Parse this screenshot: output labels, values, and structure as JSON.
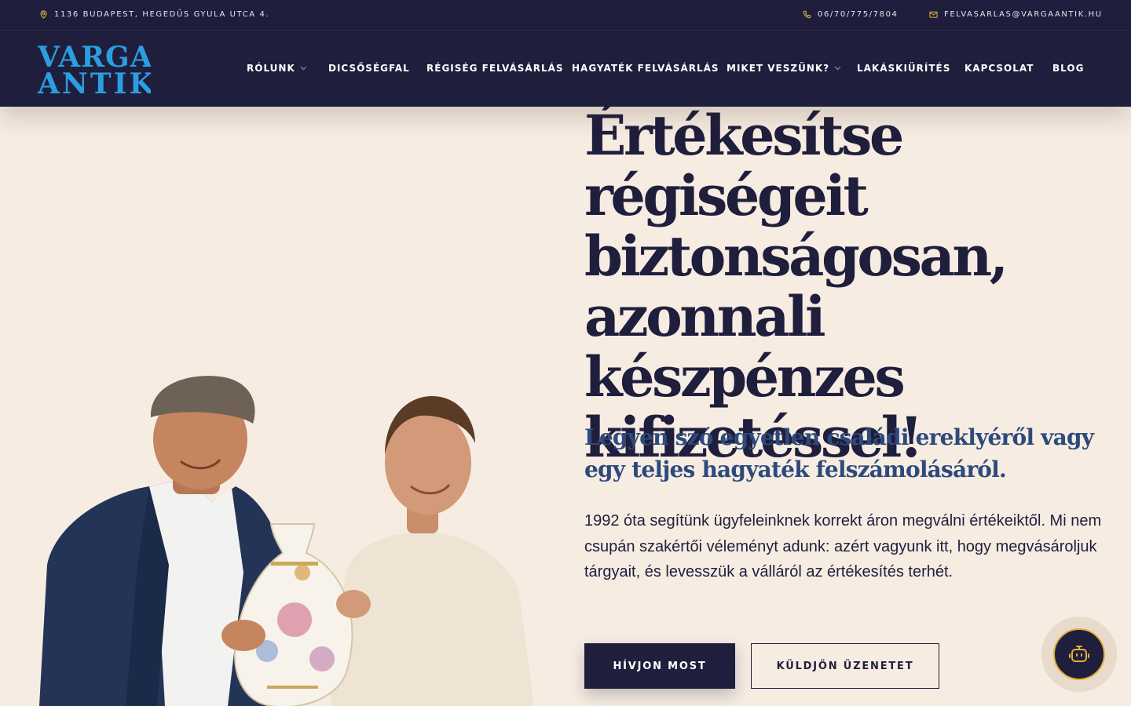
{
  "topbar": {
    "address": "1136 BUDAPEST, HEGEDŰS GYULA UTCA 4.",
    "phone": "06/70/775/7804",
    "email": "FELVASARLAS@VARGAANTIK.HU"
  },
  "logo": {
    "line1": "VARGA",
    "line2": "ANTIK"
  },
  "nav": {
    "items": [
      {
        "label": "RÓLUNK",
        "dropdown": true
      },
      {
        "label": "DICSŐSÉGFAL"
      },
      {
        "label": "RÉGISÉG FELVÁSÁRLÁS"
      },
      {
        "label": "HAGYATÉK FELVÁSÁRLÁS"
      },
      {
        "label": "MIKET VESZÜNK?",
        "dropdown": true
      },
      {
        "label": "LAKÁSKIÜRÍTÉS"
      },
      {
        "label": "KAPCSOLAT"
      },
      {
        "label": "BLOG"
      }
    ]
  },
  "hero": {
    "headline_lines": [
      "Értékesítse",
      "régiségeit",
      "biztonságosan,",
      "azonnali készpénzes",
      "kifizetéssel!"
    ],
    "subheadline": "Legyen szó egyetlen családi ereklyéről vagy egy teljes hagyaték felszámolásáról.",
    "body": "1992 óta segítünk ügyfeleinknek korrekt áron megválni értékeiktől. Mi nem csupán szakértői véleményt adunk: azért vagyunk itt, hogy megvásároljuk tárgyait, és levesszük a válláról az értékesítés terhét.",
    "primary_button": "HÍVJON MOST",
    "secondary_button": "KÜLDJÖN ÜZENETET"
  },
  "icons": {
    "address": "map-pin-icon",
    "phone": "phone-icon",
    "email": "mail-icon",
    "chat": "chatbot-icon"
  },
  "colors": {
    "navy": "#1f1e3c",
    "cream": "#f6ece2",
    "logo_blue": "#2a9ee0",
    "accent_gold": "#e2b13c",
    "subheadline_blue": "#2d4a7c"
  }
}
